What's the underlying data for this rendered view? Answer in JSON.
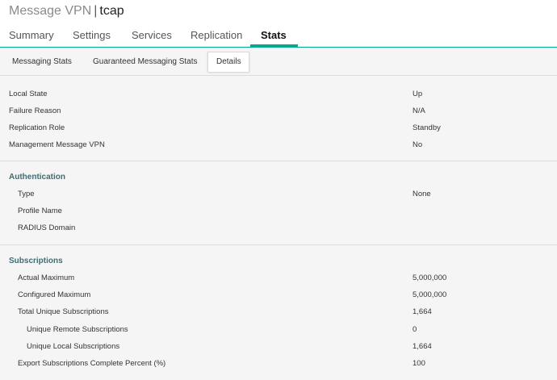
{
  "header": {
    "prefix": "Message VPN",
    "separator": "|",
    "vpn_name": "tcap"
  },
  "main_tabs": [
    {
      "label": "Summary"
    },
    {
      "label": "Settings"
    },
    {
      "label": "Services"
    },
    {
      "label": "Replication"
    },
    {
      "label": "Stats"
    }
  ],
  "active_main_tab": "Stats",
  "sub_tabs": [
    {
      "label": "Messaging Stats"
    },
    {
      "label": "Guaranteed Messaging Stats"
    },
    {
      "label": "Details"
    }
  ],
  "active_sub_tab": "Details",
  "general": [
    {
      "label": "Local State",
      "value": "Up"
    },
    {
      "label": "Failure Reason",
      "value": "N/A"
    },
    {
      "label": "Replication Role",
      "value": "Standby"
    },
    {
      "label": "Management Message VPN",
      "value": "No"
    }
  ],
  "authentication": {
    "title": "Authentication",
    "rows": [
      {
        "label": "Type",
        "value": "None"
      },
      {
        "label": "Profile Name",
        "value": ""
      },
      {
        "label": "RADIUS Domain",
        "value": ""
      }
    ]
  },
  "subscriptions": {
    "title": "Subscriptions",
    "rows": [
      {
        "label": "Actual Maximum",
        "value": "5,000,000"
      },
      {
        "label": "Configured Maximum",
        "value": "5,000,000"
      },
      {
        "label": "Total Unique Subscriptions",
        "value": "1,664"
      },
      {
        "label": "Unique Remote Subscriptions",
        "value": "0"
      },
      {
        "label": "Unique Local Subscriptions",
        "value": "1,664"
      },
      {
        "label": "Export Subscriptions Complete Percent (%)",
        "value": "100"
      }
    ]
  },
  "colors": {
    "accent": "#00a98f",
    "section_title": "#3d6e74",
    "panel_bg": "#f5f5f5"
  }
}
